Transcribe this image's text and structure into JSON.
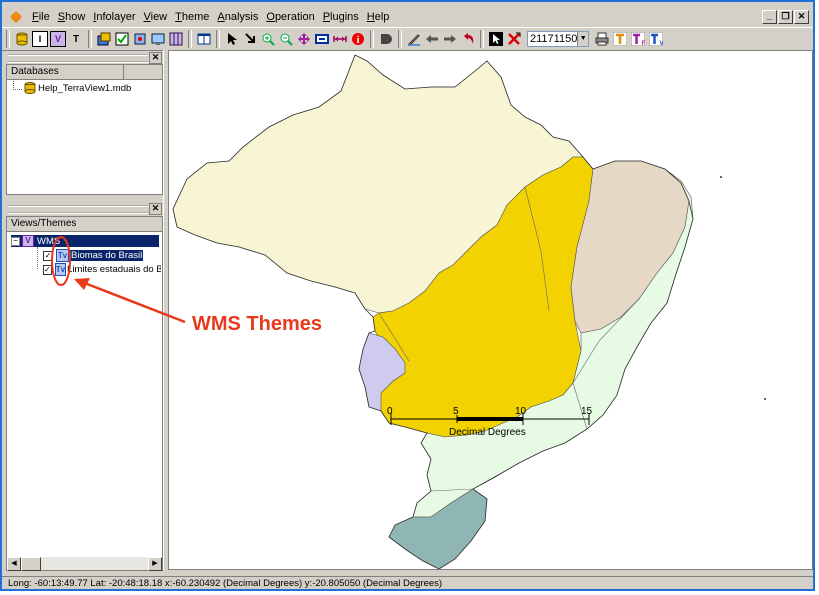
{
  "menu": {
    "items": [
      {
        "label": "File"
      },
      {
        "label": "Show"
      },
      {
        "label": "Infolayer"
      },
      {
        "label": "View"
      },
      {
        "label": "Theme"
      },
      {
        "label": "Analysis"
      },
      {
        "label": "Operation"
      },
      {
        "label": "Plugins"
      },
      {
        "label": "Help"
      }
    ]
  },
  "window_controls": {
    "minimize": "_",
    "restore": "❐",
    "close": "✕"
  },
  "toolbar": {
    "scale_value": "21171150",
    "theme_t_label": "T",
    "v_label": "V"
  },
  "databases_panel": {
    "header": "Databases",
    "db_file": "Help_TerraView1.mdb"
  },
  "views_panel": {
    "header": "Views/Themes",
    "view_name": "WMS",
    "themes": [
      {
        "label": "Biomas do Brasil",
        "checked": true,
        "selected": true
      },
      {
        "label": "Limites estaduais do Bra",
        "checked": true,
        "selected": false
      }
    ]
  },
  "annotation": {
    "text": "WMS Themes",
    "color": "#e8391a"
  },
  "map": {
    "scale_bar": {
      "ticks": [
        "0",
        "5",
        "10",
        "15"
      ],
      "unit": "Decimal Degrees"
    },
    "colors": {
      "amazon": "#f8f5d5",
      "cerrado": "#f2d200",
      "caatinga": "#e5d9c6",
      "pantanal": "#cfcbee",
      "mata_atlantica": "#e7fbe4",
      "pampa": "#8fb5b5",
      "accent": "#1f6fd6"
    }
  },
  "status": {
    "text": "Long: -60:13:49.77 Lat: -20:48:18.18  x:-60.230492 (Decimal Degrees)  y:-20.805050 (Decimal Degrees)"
  }
}
